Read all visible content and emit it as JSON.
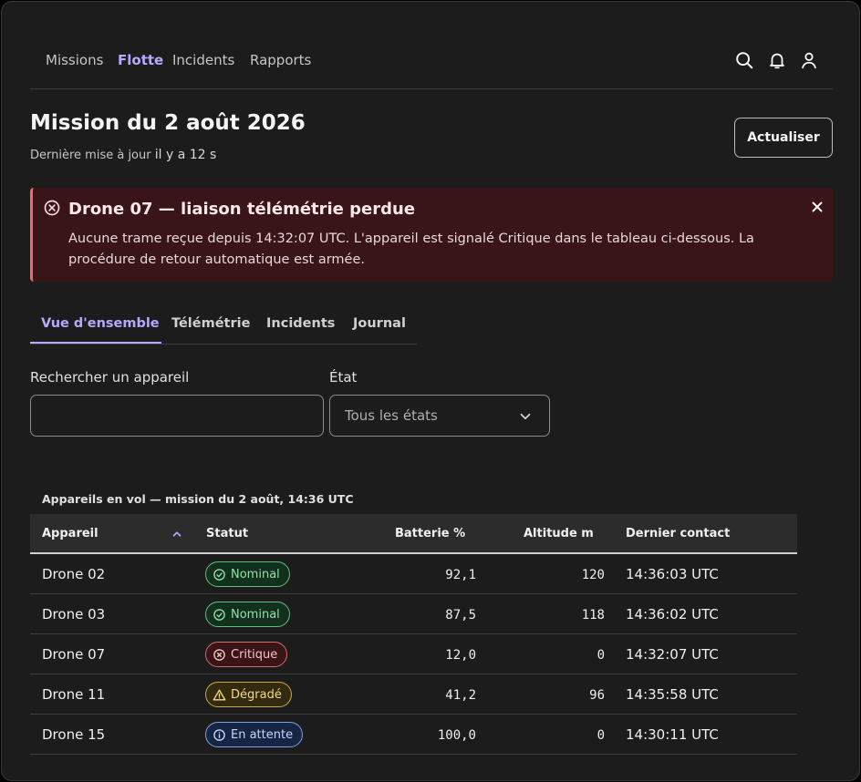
{
  "nav": {
    "links": [
      "Missions",
      "Flotte",
      "Incidents",
      "Rapports"
    ],
    "active": "Flotte",
    "icons": [
      "search-icon",
      "bell-icon",
      "user-icon"
    ]
  },
  "header": {
    "title": "Mission du 2 août 2026",
    "updated_label": "Dernière mise à jour",
    "updated_value": "il y a 12 s",
    "refresh_label": "Actualiser"
  },
  "alert": {
    "title": "Drone 07 — liaison télémétrie perdue",
    "body": "Aucune trame reçue depuis 14:32:07 UTC. L'appareil est signalé Critique dans le tableau ci-dessous. La procédure de retour automatique est armée.",
    "icon": "error-circle-icon",
    "color": "#ef6b6b"
  },
  "tabs": [
    "Vue d'ensemble",
    "Télémétrie",
    "Incidents",
    "Journal"
  ],
  "filters": {
    "search_label": "Rechercher un appareil",
    "search_value": "",
    "state_label": "État",
    "state_value": "Tous les états"
  },
  "table": {
    "caption": "Appareils en vol — mission du 2 août, 14:36 UTC",
    "columns": [
      "Appareil",
      "Statut",
      "Batterie %",
      "Altitude m",
      "Dernier contact"
    ],
    "sort_column": "Appareil",
    "sort_direction": "ascending",
    "rows": [
      {
        "device": "Drone 02",
        "status": "Nominal",
        "kind": "nominal",
        "battery": "92,1",
        "altitude": "120",
        "contact": "14:36:03 UTC"
      },
      {
        "device": "Drone 03",
        "status": "Nominal",
        "kind": "nominal",
        "battery": "87,5",
        "altitude": "118",
        "contact": "14:36:02 UTC"
      },
      {
        "device": "Drone 07",
        "status": "Critique",
        "kind": "critical",
        "battery": "12,0",
        "altitude": "0",
        "contact": "14:32:07 UTC"
      },
      {
        "device": "Drone 11",
        "status": "Dégradé",
        "kind": "degraded",
        "battery": "41,2",
        "altitude": "96",
        "contact": "14:35:58 UTC"
      },
      {
        "device": "Drone 15",
        "status": "En attente",
        "kind": "pending",
        "battery": "100,0",
        "altitude": "0",
        "contact": "14:30:11 UTC"
      }
    ]
  },
  "status_colors": {
    "nominal": {
      "fg": "#8fe0a8",
      "bg": "#13301d",
      "border": "#5fbf7f"
    },
    "critical": {
      "fg": "#f5c4c4",
      "bg": "#3a1517",
      "border": "#d46a6a"
    },
    "degraded": {
      "fg": "#f0da8a",
      "bg": "#332a0f",
      "border": "#c9a83f"
    },
    "pending": {
      "fg": "#c4d6ff",
      "bg": "#172544",
      "border": "#7f9fe0"
    }
  },
  "accent": "#b7a8ff"
}
